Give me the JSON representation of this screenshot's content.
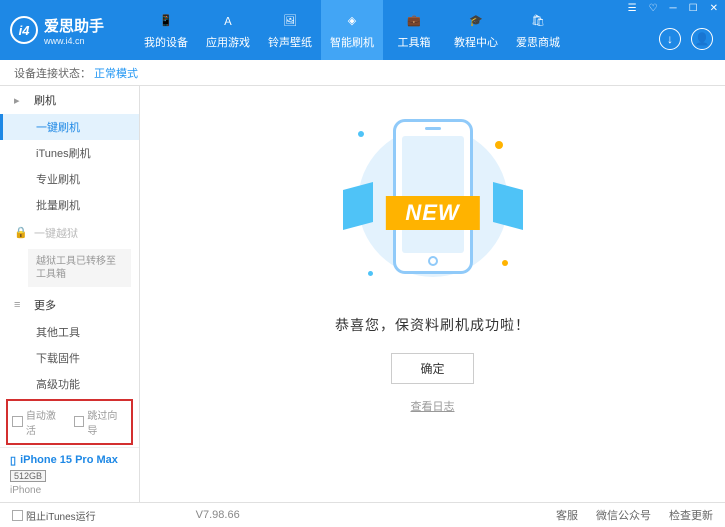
{
  "header": {
    "appName": "爱思助手",
    "url": "www.i4.cn",
    "nav": [
      "我的设备",
      "应用游戏",
      "铃声壁纸",
      "智能刷机",
      "工具箱",
      "教程中心",
      "爱思商城"
    ]
  },
  "status": {
    "label": "设备连接状态：",
    "value": "正常模式"
  },
  "sidebar": {
    "sec1": "刷机",
    "items1": [
      "一键刷机",
      "iTunes刷机",
      "专业刷机",
      "批量刷机"
    ],
    "sec2": "一键越狱",
    "note": "越狱工具已转移至工具箱",
    "sec3": "更多",
    "items3": [
      "其他工具",
      "下载固件",
      "高级功能"
    ],
    "autoActivate": "自动激活",
    "skipGuide": "跳过向导"
  },
  "device": {
    "name": "iPhone 15 Pro Max",
    "storage": "512GB",
    "type": "iPhone"
  },
  "content": {
    "banner": "NEW",
    "message": "恭喜您，保资料刷机成功啦！",
    "okBtn": "确定",
    "logLink": "查看日志"
  },
  "footer": {
    "blockItunes": "阻止iTunes运行",
    "version": "V7.98.66",
    "items": [
      "客服",
      "微信公众号",
      "检查更新"
    ]
  }
}
